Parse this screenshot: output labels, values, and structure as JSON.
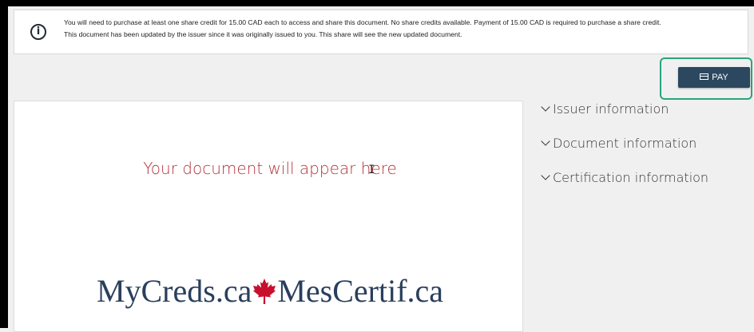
{
  "notice": {
    "icon": "info-circle-icon",
    "line1": "You will need to purchase at least one share credit for 15.00 CAD each to access and share this document. No share credits available. Payment of 15.00 CAD is required to purchase a share credit.",
    "line2": "This document has been updated by the issuer since it was originally issued to you. This share will see the new updated document."
  },
  "pay_button": {
    "label": "PAY",
    "icon": "credit-card-icon",
    "color": "#2c4760",
    "highlight_color": "#2aa47f"
  },
  "document": {
    "placeholder": "Your document will appear here",
    "placeholder_color": "#b5323a",
    "brand": {
      "left": "MyCreds.ca",
      "right": "MesCertif.ca",
      "icon": "maple-leaf-icon",
      "icon_color": "#c8102e",
      "text_color": "#2a3f5c"
    }
  },
  "accordion": {
    "items": [
      {
        "label": "Issuer information",
        "icon": "chevron-down-icon"
      },
      {
        "label": "Document information",
        "icon": "chevron-down-icon"
      },
      {
        "label": "Certification information",
        "icon": "chevron-down-icon"
      }
    ]
  }
}
